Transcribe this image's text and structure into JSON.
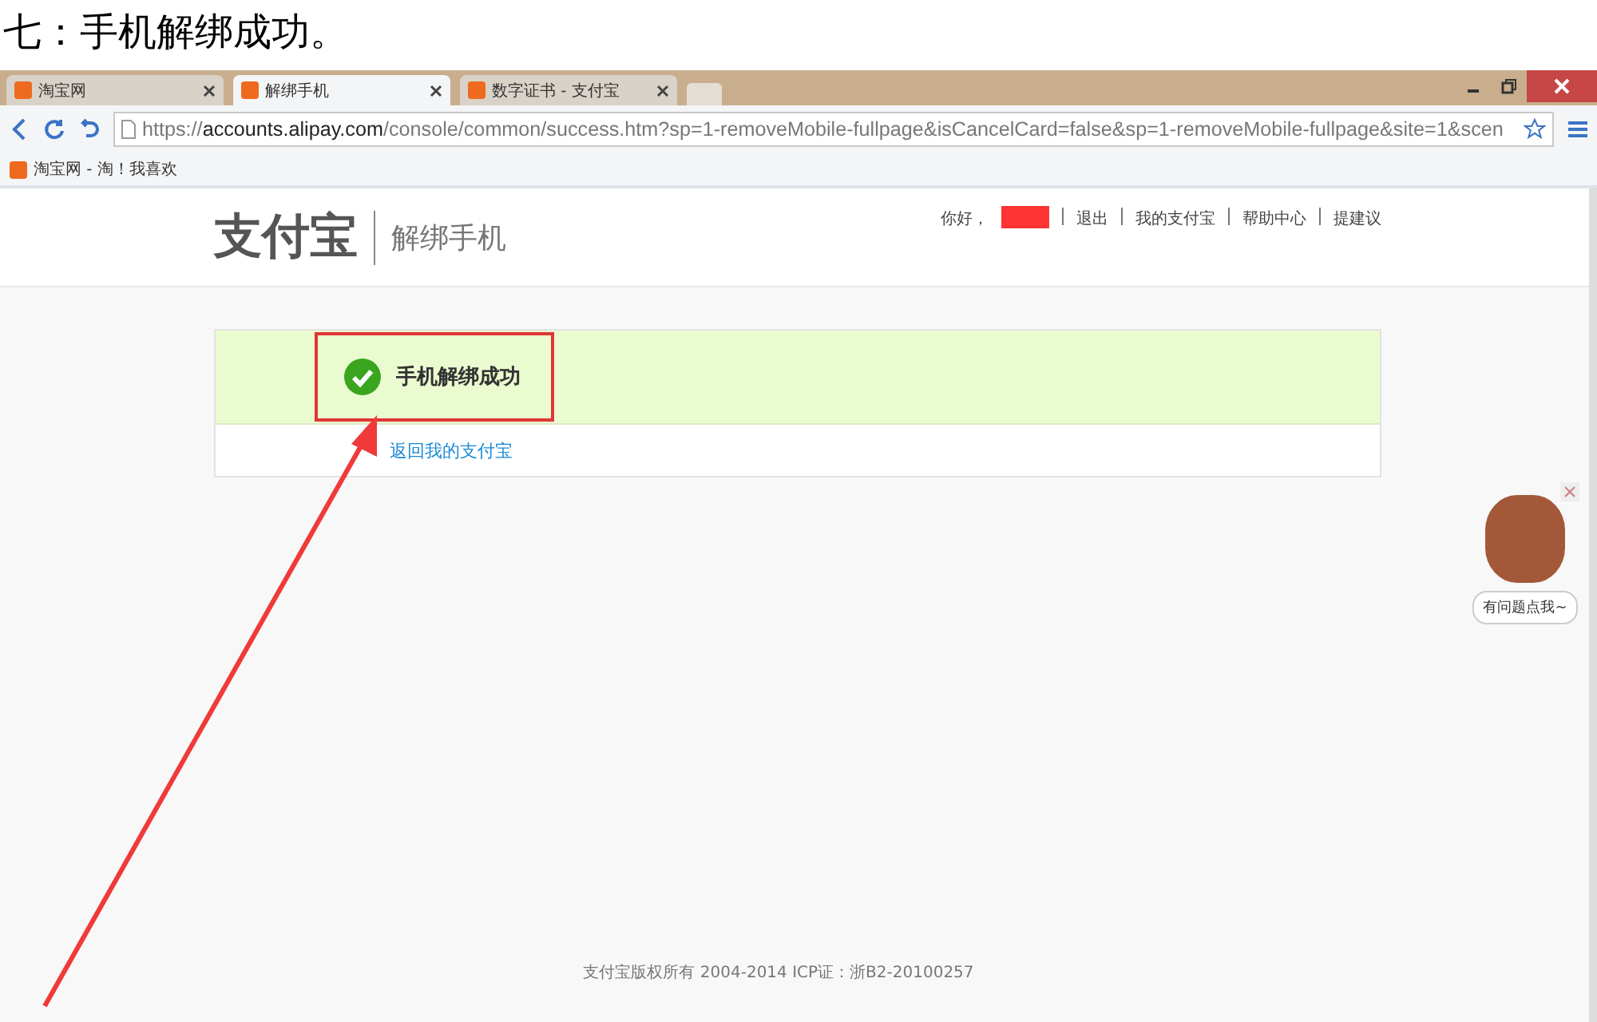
{
  "heading": "七：手机解绑成功。",
  "tabs": [
    {
      "label": "淘宝网",
      "selected": false
    },
    {
      "label": "解绑手机",
      "selected": true
    },
    {
      "label": "数字证书 - 支付宝",
      "selected": false
    }
  ],
  "address": {
    "scheme": "https://",
    "host": "accounts.alipay.com",
    "path": "/console/common/success.htm?sp=1-removeMobile-fullpage&isCancelCard=false&sp=1-removeMobile-fullpage&site=1&scen"
  },
  "bookmarks": [
    {
      "label": "淘宝网 - 淘！我喜欢"
    }
  ],
  "site": {
    "logo": "支付宝",
    "page_title": "解绑手机",
    "greeting": "你好，",
    "nav": [
      "退出",
      "我的支付宝",
      "帮助中心",
      "提建议"
    ]
  },
  "result": {
    "message": "手机解绑成功",
    "link": "返回我的支付宝"
  },
  "helper": {
    "label": "有问题点我~"
  },
  "footer": "支付宝版权所有 2004-2014 ICP证：浙B2-20100257"
}
